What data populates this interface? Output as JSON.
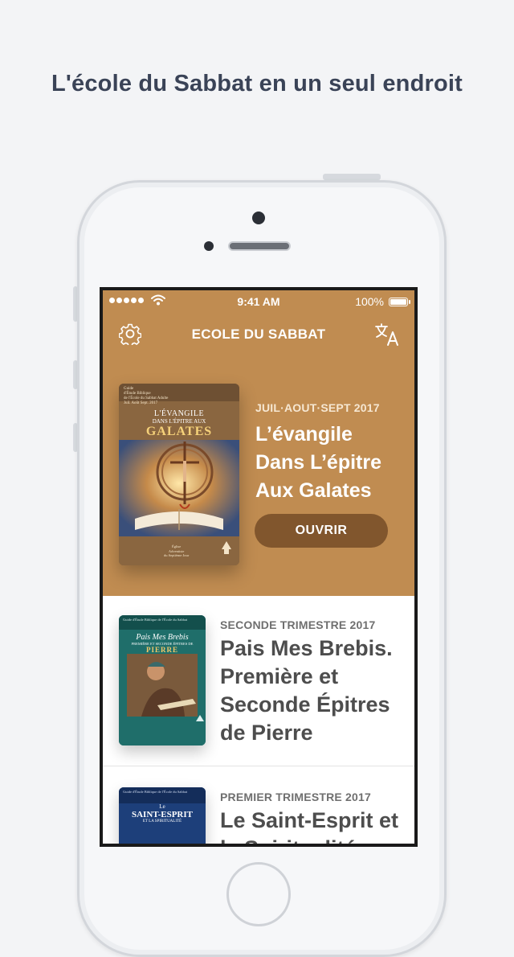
{
  "headline": "L'école du Sabbat en un seul endroit",
  "status_bar": {
    "time": "9:41 AM",
    "battery": "100%"
  },
  "nav": {
    "title": "ECOLE DU SABBAT",
    "left_icon": "gear-icon",
    "right_icon": "translate-icon"
  },
  "colors": {
    "hero_bg": "#c08c51",
    "open_button": "#81562d",
    "accent_text": "#f6e7d2"
  },
  "featured": {
    "quarter": "JUIL·AOUT·SEPT 2017",
    "title": "L’évangile Dans L’épitre Aux Galates",
    "button": "OUVRIR",
    "cover": {
      "top_line1": "Guide",
      "top_line2": "d'Étude Biblique",
      "top_line3": "de l'École du Sabbat Adulte",
      "date": "Juil. Août Sept. 2017",
      "heading_small": "L'ÉVANGILE",
      "heading_sub": "DANS L'ÉPITRE AUX",
      "heading_big": "GALATES",
      "publisher_line1": "Église",
      "publisher_line2": "Adventiste",
      "publisher_line3": "du Septième Jour"
    }
  },
  "lessons": [
    {
      "quarter": "SECONDE TRIMESTRE 2017",
      "title": "Pais Mes Brebis. Première et Seconde Épitres de Pierre",
      "cover": {
        "top_line": "Guide d'Étude Biblique de l'École du Sabbat",
        "heading_script": "Pais Mes Brebis",
        "heading_sub": "PREMIÈRE ET SECONDE ÉPITRES DE",
        "heading_big": "PIERRE"
      }
    },
    {
      "quarter": "PREMIER TRIMESTRE 2017",
      "title": "Le Saint-Esprit et la Spiritualité",
      "cover": {
        "top_line": "Guide d'Étude Biblique de l'École du Sabbat",
        "heading_small": "Le",
        "heading_big": "SAINT-ESPRIT",
        "heading_sub": "ET LA SPIRITUALITÉ"
      }
    }
  ]
}
